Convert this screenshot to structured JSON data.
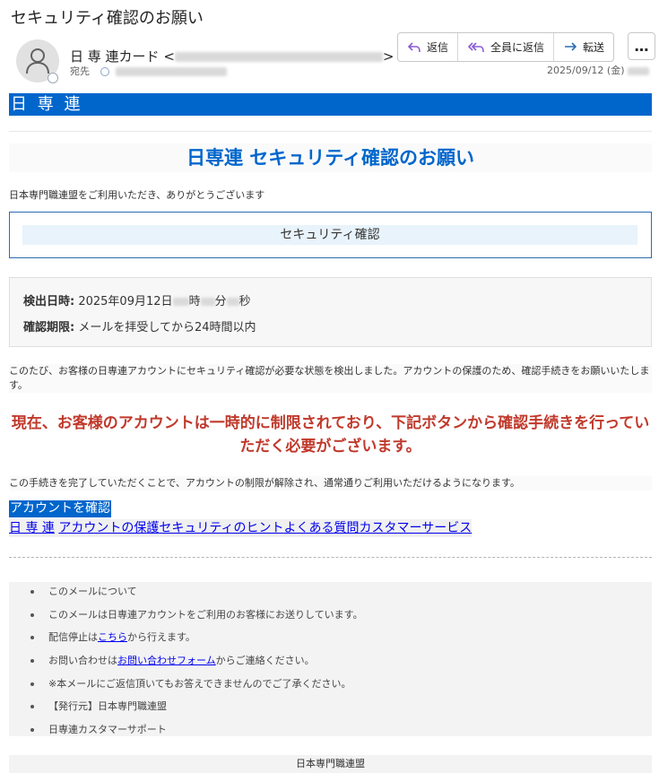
{
  "email": {
    "subject": "セキュリティ確認のお願い",
    "sender_name": "日 専 連カード",
    "to_label": "宛先",
    "date": "2025/09/12 (金)"
  },
  "toolbar": {
    "reply": "返信",
    "reply_all": "全員に返信",
    "forward": "転送",
    "more": "…"
  },
  "body": {
    "brand": "日 専 連",
    "headline": "日専連 セキュリティ確認のお願い",
    "thanks": "日本専門職連盟をご利用いただき、ありがとうございます",
    "security_box": "セキュリティ確認",
    "detected_label": "検出日時:",
    "detected_value": "2025年09月12日",
    "detected_hour": "時",
    "detected_min": "分",
    "detected_sec": "秒",
    "deadline_label": "確認期限:",
    "deadline_value": "メールを拝受してから24時間以内",
    "para1": "このたび、お客様の日専連アカウントにセキュリティ確認が必要な状態を検出しました。アカウントの保護のため、確認手続きをお願いいたします。",
    "warning": "現在、お客様のアカウントは一時的に制限されており、下記ボタンから確認手続きを行っていただく必要がございます。",
    "para2": "この手続きを完了していただくことで、アカウントの制限が解除され、通常通りご利用いただけるようになります。",
    "confirm_button": "アカウントを確認",
    "links": [
      "日 専 連",
      "アカウントの保護",
      "セキュリティのヒント",
      "よくある質問",
      "カスタマーサービス"
    ]
  },
  "footer": {
    "items": {
      "about": "このメールについて",
      "sent_to": "このメールは日専連アカウントをご利用のお客様にお送りしています。",
      "unsub_pre": "配信停止は",
      "unsub_link": "こちら",
      "unsub_post": "から行えます。",
      "contact_pre": "お問い合わせは",
      "contact_link": "お問い合わせフォーム",
      "contact_post": "からご連絡ください。",
      "noreply": "※本メールにご返信頂いてもお答えできませんのでご了承ください。",
      "publisher": "【発行元】日本専門職連盟",
      "support": "日専連カスタマーサポート"
    },
    "org": "日本専門職連盟"
  },
  "colors": {
    "brand_blue": "#0066cc",
    "warning_red": "#c0392b"
  }
}
